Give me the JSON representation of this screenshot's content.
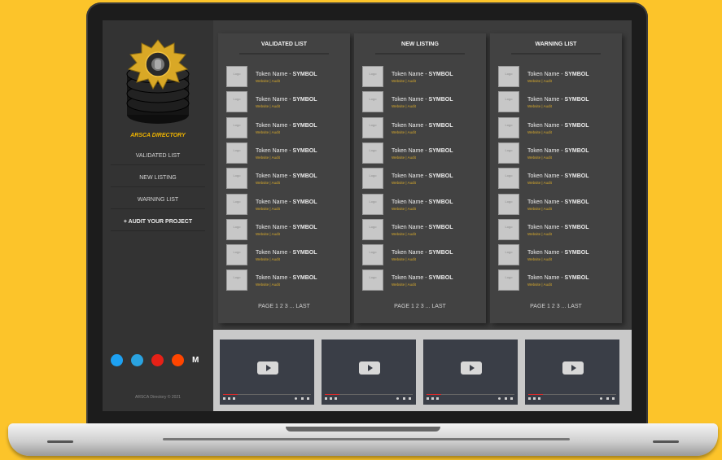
{
  "sidebar": {
    "brand": "ARSCA DIRECTORY",
    "nav": [
      "VALIDATED LIST",
      "NEW LISTING",
      "WARNING LIST",
      "+ AUDIT YOUR PROJECT"
    ],
    "socials": [
      {
        "name": "twitter-icon",
        "color": "#1da1f2"
      },
      {
        "name": "telegram-icon",
        "color": "#2aa3e0"
      },
      {
        "name": "youtube-icon",
        "color": "#e62117"
      },
      {
        "name": "reddit-icon",
        "color": "#ff4500"
      },
      {
        "name": "medium-icon",
        "color": "#ffffff"
      }
    ],
    "copyright": "ARSCA Directory © 2021"
  },
  "columns": [
    {
      "title": "VALIDATED LIST",
      "pager": "PAGE 1 2 3 ... LAST"
    },
    {
      "title": "NEW LISTING",
      "pager": "PAGE 1 2 3 ... LAST"
    },
    {
      "title": "WARNING LIST",
      "pager": "PAGE 1 2 3 ... LAST"
    }
  ],
  "token": {
    "logo": "Logo",
    "name": "Token Name - ",
    "symbol": "SYMBOL",
    "links": "Website | Audit"
  },
  "videos": 4,
  "colors": {
    "accent": "#f0b400",
    "background": "#fcc42a",
    "links": "#d8aa2c"
  }
}
